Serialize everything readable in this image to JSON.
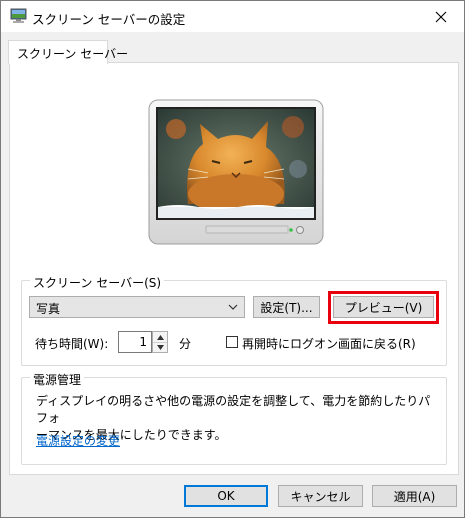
{
  "window": {
    "title": "スクリーン セーバーの設定",
    "close_icon": "close-icon"
  },
  "tabs": [
    {
      "label": "スクリーン セーバー"
    }
  ],
  "preview": {
    "icon": "monitor-icon",
    "image": "cat-photo"
  },
  "screensaver": {
    "group_label": "スクリーン セーバー(S)",
    "selected": "写真",
    "settings_label": "設定(T)...",
    "preview_label": "プレビュー(V)",
    "wait_label": "待ち時間(W):",
    "wait_value": "1",
    "wait_unit": "分",
    "logon_label": "再開時にログオン画面に戻る(R)",
    "logon_checked": false
  },
  "power": {
    "group_label": "電源管理",
    "description": "ディスプレイの明るさや他の電源の設定を調整して、電力を節約したりパフォーマンスを最大にしたりできます。",
    "description_line1": "ディスプレイの明るさや他の電源の設定を調整して、電力を節約したりパフォ",
    "description_line2": "ーマンスを最大にしたりできます。",
    "link_label": "電源設定の変更"
  },
  "footer": {
    "ok_label": "OK",
    "cancel_label": "キャンセル",
    "apply_label": "適用(A)"
  },
  "colors": {
    "highlight": "#e8000f",
    "link": "#0066cc",
    "default_button_border": "#0078d7"
  }
}
